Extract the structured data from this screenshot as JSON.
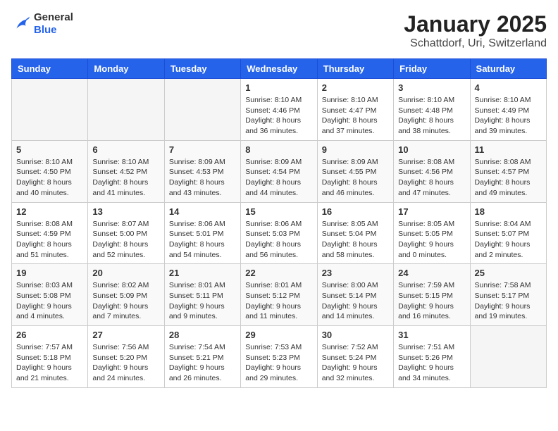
{
  "header": {
    "logo": {
      "general": "General",
      "blue": "Blue"
    },
    "title": "January 2025",
    "location": "Schattdorf, Uri, Switzerland"
  },
  "calendar": {
    "weekdays": [
      "Sunday",
      "Monday",
      "Tuesday",
      "Wednesday",
      "Thursday",
      "Friday",
      "Saturday"
    ],
    "weeks": [
      [
        {
          "day": "",
          "info": ""
        },
        {
          "day": "",
          "info": ""
        },
        {
          "day": "",
          "info": ""
        },
        {
          "day": "1",
          "info": "Sunrise: 8:10 AM\nSunset: 4:46 PM\nDaylight: 8 hours and 36 minutes."
        },
        {
          "day": "2",
          "info": "Sunrise: 8:10 AM\nSunset: 4:47 PM\nDaylight: 8 hours and 37 minutes."
        },
        {
          "day": "3",
          "info": "Sunrise: 8:10 AM\nSunset: 4:48 PM\nDaylight: 8 hours and 38 minutes."
        },
        {
          "day": "4",
          "info": "Sunrise: 8:10 AM\nSunset: 4:49 PM\nDaylight: 8 hours and 39 minutes."
        }
      ],
      [
        {
          "day": "5",
          "info": "Sunrise: 8:10 AM\nSunset: 4:50 PM\nDaylight: 8 hours and 40 minutes."
        },
        {
          "day": "6",
          "info": "Sunrise: 8:10 AM\nSunset: 4:52 PM\nDaylight: 8 hours and 41 minutes."
        },
        {
          "day": "7",
          "info": "Sunrise: 8:09 AM\nSunset: 4:53 PM\nDaylight: 8 hours and 43 minutes."
        },
        {
          "day": "8",
          "info": "Sunrise: 8:09 AM\nSunset: 4:54 PM\nDaylight: 8 hours and 44 minutes."
        },
        {
          "day": "9",
          "info": "Sunrise: 8:09 AM\nSunset: 4:55 PM\nDaylight: 8 hours and 46 minutes."
        },
        {
          "day": "10",
          "info": "Sunrise: 8:08 AM\nSunset: 4:56 PM\nDaylight: 8 hours and 47 minutes."
        },
        {
          "day": "11",
          "info": "Sunrise: 8:08 AM\nSunset: 4:57 PM\nDaylight: 8 hours and 49 minutes."
        }
      ],
      [
        {
          "day": "12",
          "info": "Sunrise: 8:08 AM\nSunset: 4:59 PM\nDaylight: 8 hours and 51 minutes."
        },
        {
          "day": "13",
          "info": "Sunrise: 8:07 AM\nSunset: 5:00 PM\nDaylight: 8 hours and 52 minutes."
        },
        {
          "day": "14",
          "info": "Sunrise: 8:06 AM\nSunset: 5:01 PM\nDaylight: 8 hours and 54 minutes."
        },
        {
          "day": "15",
          "info": "Sunrise: 8:06 AM\nSunset: 5:03 PM\nDaylight: 8 hours and 56 minutes."
        },
        {
          "day": "16",
          "info": "Sunrise: 8:05 AM\nSunset: 5:04 PM\nDaylight: 8 hours and 58 minutes."
        },
        {
          "day": "17",
          "info": "Sunrise: 8:05 AM\nSunset: 5:05 PM\nDaylight: 9 hours and 0 minutes."
        },
        {
          "day": "18",
          "info": "Sunrise: 8:04 AM\nSunset: 5:07 PM\nDaylight: 9 hours and 2 minutes."
        }
      ],
      [
        {
          "day": "19",
          "info": "Sunrise: 8:03 AM\nSunset: 5:08 PM\nDaylight: 9 hours and 4 minutes."
        },
        {
          "day": "20",
          "info": "Sunrise: 8:02 AM\nSunset: 5:09 PM\nDaylight: 9 hours and 7 minutes."
        },
        {
          "day": "21",
          "info": "Sunrise: 8:01 AM\nSunset: 5:11 PM\nDaylight: 9 hours and 9 minutes."
        },
        {
          "day": "22",
          "info": "Sunrise: 8:01 AM\nSunset: 5:12 PM\nDaylight: 9 hours and 11 minutes."
        },
        {
          "day": "23",
          "info": "Sunrise: 8:00 AM\nSunset: 5:14 PM\nDaylight: 9 hours and 14 minutes."
        },
        {
          "day": "24",
          "info": "Sunrise: 7:59 AM\nSunset: 5:15 PM\nDaylight: 9 hours and 16 minutes."
        },
        {
          "day": "25",
          "info": "Sunrise: 7:58 AM\nSunset: 5:17 PM\nDaylight: 9 hours and 19 minutes."
        }
      ],
      [
        {
          "day": "26",
          "info": "Sunrise: 7:57 AM\nSunset: 5:18 PM\nDaylight: 9 hours and 21 minutes."
        },
        {
          "day": "27",
          "info": "Sunrise: 7:56 AM\nSunset: 5:20 PM\nDaylight: 9 hours and 24 minutes."
        },
        {
          "day": "28",
          "info": "Sunrise: 7:54 AM\nSunset: 5:21 PM\nDaylight: 9 hours and 26 minutes."
        },
        {
          "day": "29",
          "info": "Sunrise: 7:53 AM\nSunset: 5:23 PM\nDaylight: 9 hours and 29 minutes."
        },
        {
          "day": "30",
          "info": "Sunrise: 7:52 AM\nSunset: 5:24 PM\nDaylight: 9 hours and 32 minutes."
        },
        {
          "day": "31",
          "info": "Sunrise: 7:51 AM\nSunset: 5:26 PM\nDaylight: 9 hours and 34 minutes."
        },
        {
          "day": "",
          "info": ""
        }
      ]
    ]
  }
}
